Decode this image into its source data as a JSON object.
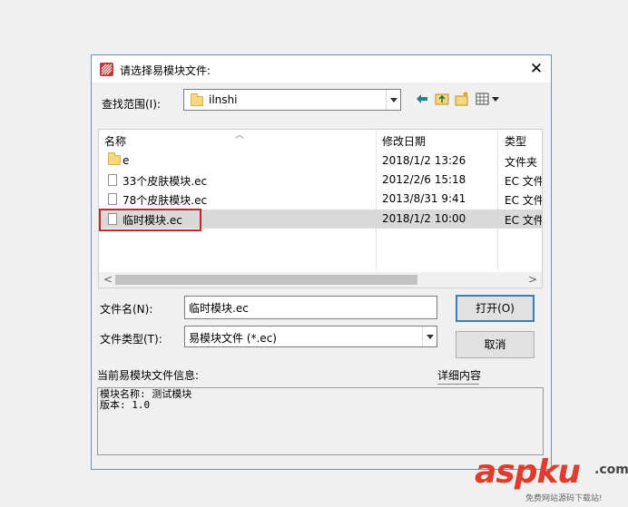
{
  "dialog": {
    "title": "请选择易模块文件:",
    "close_glyph": "✕"
  },
  "lookin": {
    "label": "查找范围(I):",
    "value": "ilnshi"
  },
  "toolbar": {
    "icons": [
      "back-arrow-icon",
      "up-folder-icon",
      "new-folder-icon",
      "view-menu-icon"
    ],
    "accent": "#2a7d8c"
  },
  "filelist": {
    "columns": {
      "name": "名称",
      "date": "修改日期",
      "type": "类型"
    },
    "rows": [
      {
        "icon": "folder-icon",
        "name": "e",
        "date": "2018/1/2 13:26",
        "type": "文件夹"
      },
      {
        "icon": "file-icon",
        "name": "33个皮肤模块.ec",
        "date": "2012/2/6 15:18",
        "type": "EC 文件"
      },
      {
        "icon": "file-icon",
        "name": "78个皮肤模块.ec",
        "date": "2013/8/31 9:41",
        "type": "EC 文件"
      },
      {
        "icon": "file-icon",
        "name": "临时模块.ec",
        "date": "2018/1/2 10:00",
        "type": "EC 文件"
      }
    ],
    "selected_index": 3,
    "highlight_color": "#c0282a"
  },
  "filename": {
    "label": "文件名(N):",
    "value": "临时模块.ec"
  },
  "filetype": {
    "label": "文件类型(T):",
    "value": "易模块文件 (*.ec)"
  },
  "buttons": {
    "open": "打开(O)",
    "cancel": "取消"
  },
  "info": {
    "label": "当前易模块文件信息:",
    "detail_label": "详细内容",
    "lines": [
      "模块名称: 测试模块",
      "版本: 1.0"
    ]
  },
  "watermark": {
    "brand": "aspku",
    "suffix": ".com",
    "tagline": "免费网站源码下载站!",
    "color": "#e03c2d"
  }
}
